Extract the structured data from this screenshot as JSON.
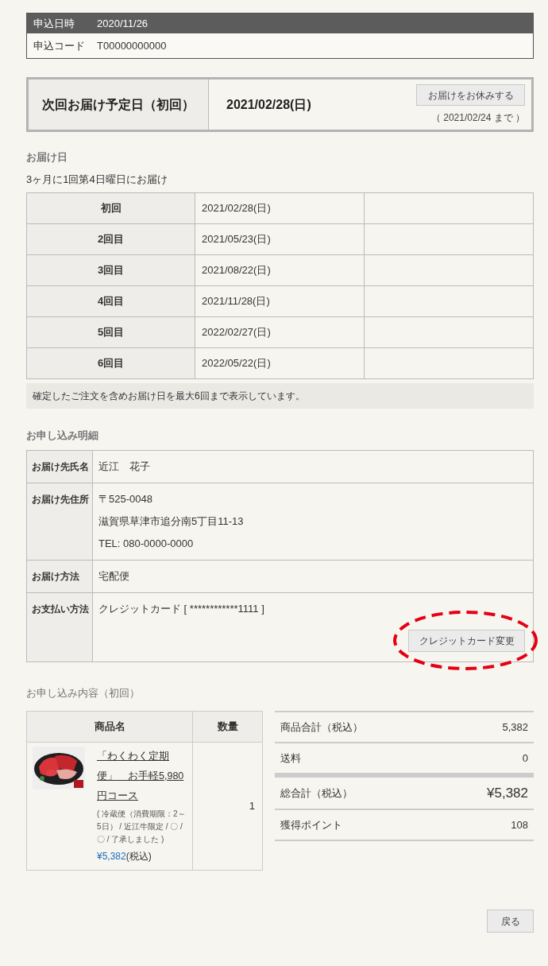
{
  "order_info": [
    {
      "label": "申込日時",
      "value": "2020/11/26",
      "kind": "header"
    },
    {
      "label": "申込コード",
      "value": "T00000000000",
      "kind": "plain"
    }
  ],
  "next_delivery": {
    "label": "次回お届け予定日（初回）",
    "date": "2021/02/28(日)",
    "skip_button": "お届けをお休みする",
    "deadline": "（ 2021/02/24 まで ）"
  },
  "schedule": {
    "heading": "お届け日",
    "frequency": "3ヶ月に1回第4日曜日にお届け",
    "rows": [
      {
        "round": "初回",
        "date": "2021/02/28(日)"
      },
      {
        "round": "2回目",
        "date": "2021/05/23(日)"
      },
      {
        "round": "3回目",
        "date": "2021/08/22(日)"
      },
      {
        "round": "4回目",
        "date": "2021/11/28(日)"
      },
      {
        "round": "5回目",
        "date": "2022/02/27(日)"
      },
      {
        "round": "6回目",
        "date": "2022/05/22(日)"
      }
    ],
    "note": "確定したご注文を含めお届け日を最大6回まで表示しています。"
  },
  "details": {
    "heading": "お申し込み明細",
    "rows": [
      {
        "label": "お届け先氏名",
        "lines": [
          "近江　花子"
        ]
      },
      {
        "label": "お届け先住所",
        "lines": [
          "〒525-0048",
          "滋賀県草津市追分南5丁目11-13",
          "TEL: 080-0000-0000"
        ]
      },
      {
        "label": "お届け方法",
        "lines": [
          "宅配便"
        ]
      },
      {
        "label": "お支払い方法",
        "lines": [
          "クレジットカード [ ************1111 ]"
        ],
        "button": "クレジットカード変更",
        "highlighted": true
      }
    ]
  },
  "contents": {
    "heading": "お申し込み内容（初回）",
    "columns": [
      "商品名",
      "数量"
    ],
    "items": [
      {
        "name": "「わくわく定期便」　お手軽5,980円コース",
        "options": "( 冷蔵便（消費期限：2～5日） / 近江牛限定 / 〇 / 〇 / 了承しました )",
        "price": "¥5,382",
        "tax": "(税込)",
        "quantity": "1"
      }
    ],
    "summary": [
      {
        "label": "商品合計（税込）",
        "value": "5,382",
        "kind": "normal"
      },
      {
        "label": "送料",
        "value": "0",
        "kind": "normal"
      },
      {
        "label": "総合計（税込）",
        "value": "¥5,382",
        "kind": "total"
      },
      {
        "label": "獲得ポイント",
        "value": "108",
        "kind": "normal"
      }
    ]
  },
  "back_button": "戻る"
}
